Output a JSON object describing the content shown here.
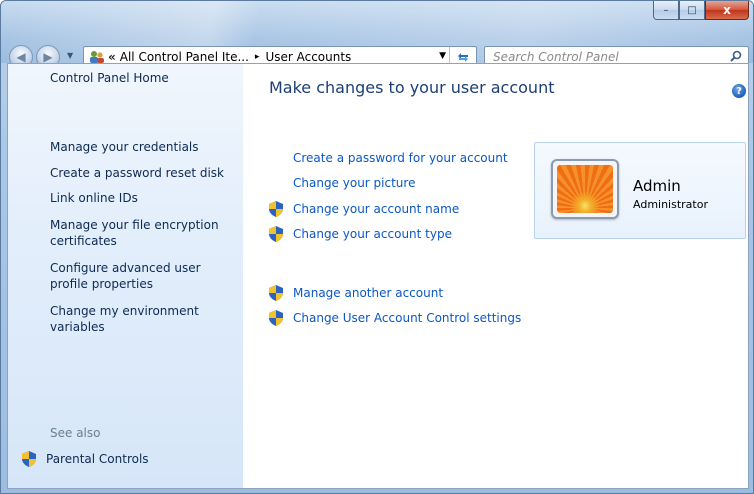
{
  "window": {
    "caption_buttons": {
      "minimize": "–",
      "maximize": "□",
      "close": "x"
    }
  },
  "navigation": {
    "back_icon": "back-arrow-icon",
    "forward_icon": "forward-arrow-icon",
    "address": {
      "chevrons": "«",
      "segment1": "All Control Panel Ite...",
      "segment2": "User Accounts",
      "separator": "▸"
    },
    "search": {
      "placeholder": "Search Control Panel"
    }
  },
  "sidebar": {
    "home": "Control Panel Home",
    "links": [
      "Manage your credentials",
      "Create a password reset disk",
      "Link online IDs",
      "Manage your file encryption certificates",
      "Configure advanced user profile properties",
      "Change my environment variables"
    ],
    "see_also": "See also",
    "parental": "Parental Controls"
  },
  "main": {
    "title": "Make changes to your user account",
    "tasks": [
      "Create a password for your account",
      "Change your picture",
      "Change your account name",
      "Change your account type"
    ],
    "other_tasks": [
      "Manage another account",
      "Change User Account Control settings"
    ]
  },
  "account": {
    "name": "Admin",
    "role": "Administrator"
  },
  "colors": {
    "link": "#0b57c4",
    "title": "#1c3f76",
    "sidebar_text": "#0d2a52"
  }
}
